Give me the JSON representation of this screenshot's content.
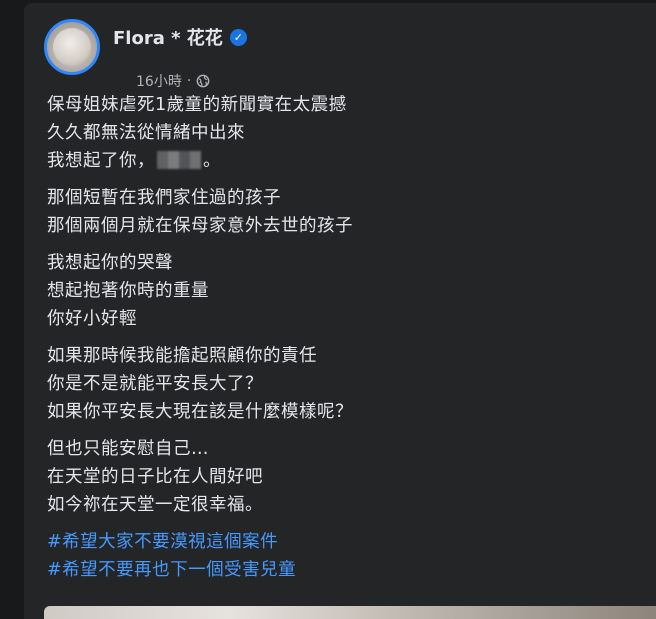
{
  "post": {
    "author": "Flora * 花花",
    "timestamp": "16小時",
    "separator": "·",
    "verified_icon": "verified-badge-icon",
    "audience_icon": "globe-icon",
    "paragraphs": [
      [
        "保母姐妹虐死1歲童的新聞實在太震撼",
        "久久都無法從情緒中出來"
      ],
      [
        "那個短暫在我們家住過的孩子",
        "那個兩個月就在保母家意外去世的孩子"
      ],
      [
        "我想起你的哭聲",
        "想起抱著你時的重量",
        "你好小好輕"
      ],
      [
        "如果那時候我能擔起照顧你的責任",
        "你是不是就能平安長大了？",
        "如果你平安長大現在該是什麼模樣呢？"
      ],
      [
        "但也只能安慰自己…",
        "在天堂的日子比在人間好吧",
        "如今祢在天堂一定很幸福。"
      ]
    ],
    "line3_prefix": "我想起了你，",
    "line3_suffix": "。",
    "hashtags": [
      "#希望大家不要漠視這個案件",
      "#希望不要再也下一個受害兒童"
    ]
  },
  "colors": {
    "background": "#18191a",
    "card": "#242526",
    "text": "#e4e6eb",
    "secondary": "#b0b3b8",
    "link": "#4599ff",
    "accent": "#1b74e4"
  }
}
